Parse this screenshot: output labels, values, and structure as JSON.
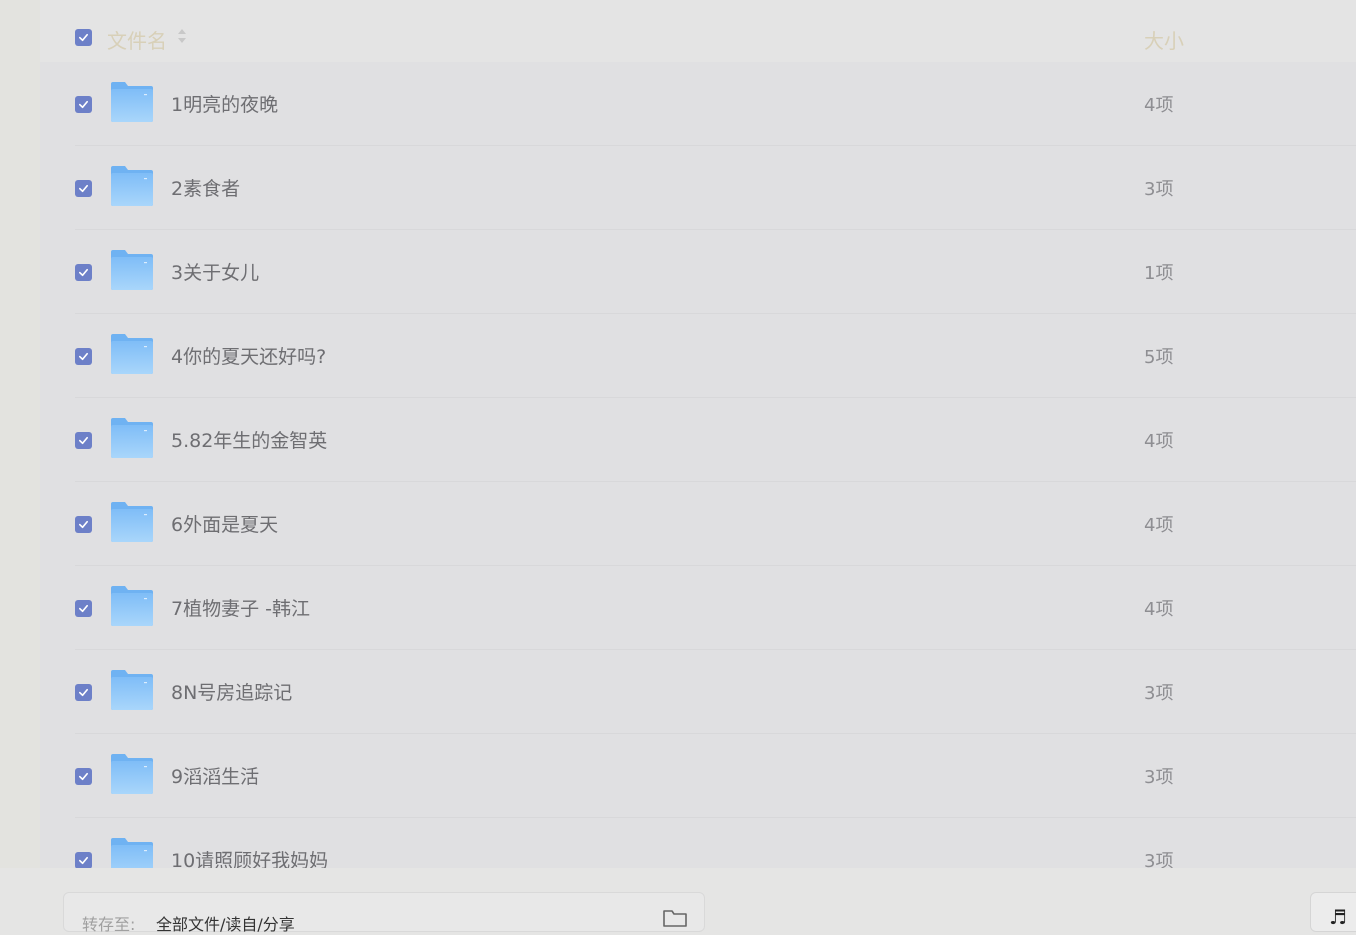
{
  "header": {
    "name_label": "文件名",
    "size_label": "大小",
    "select_all_checked": true
  },
  "files": [
    {
      "name": "1明亮的夜晚",
      "size": "4项",
      "checked": true
    },
    {
      "name": "2素食者",
      "size": "3项",
      "checked": true
    },
    {
      "name": "3关于女儿",
      "size": "1项",
      "checked": true
    },
    {
      "name": "4你的夏天还好吗?",
      "size": "5项",
      "checked": true
    },
    {
      "name": "5.82年生的金智英",
      "size": "4项",
      "checked": true
    },
    {
      "name": "6外面是夏天",
      "size": "4项",
      "checked": true
    },
    {
      "name": "7植物妻子 -韩江",
      "size": "4项",
      "checked": true
    },
    {
      "name": "8N号房追踪记",
      "size": "3项",
      "checked": true
    },
    {
      "name": "9滔滔生活",
      "size": "3项",
      "checked": true
    },
    {
      "name": "10请照顾好我妈妈",
      "size": "3项",
      "checked": true
    }
  ],
  "save_bar": {
    "label": "转存至:",
    "path": "全部文件/读自/分享"
  },
  "colors": {
    "checkbox": "#6d80c8",
    "folder": "#8cc4f8",
    "header_text": "#d8d0b8"
  },
  "icons": {
    "folder": "folder-icon",
    "checkbox": "checkbox-icon",
    "sort": "sort-icon"
  }
}
